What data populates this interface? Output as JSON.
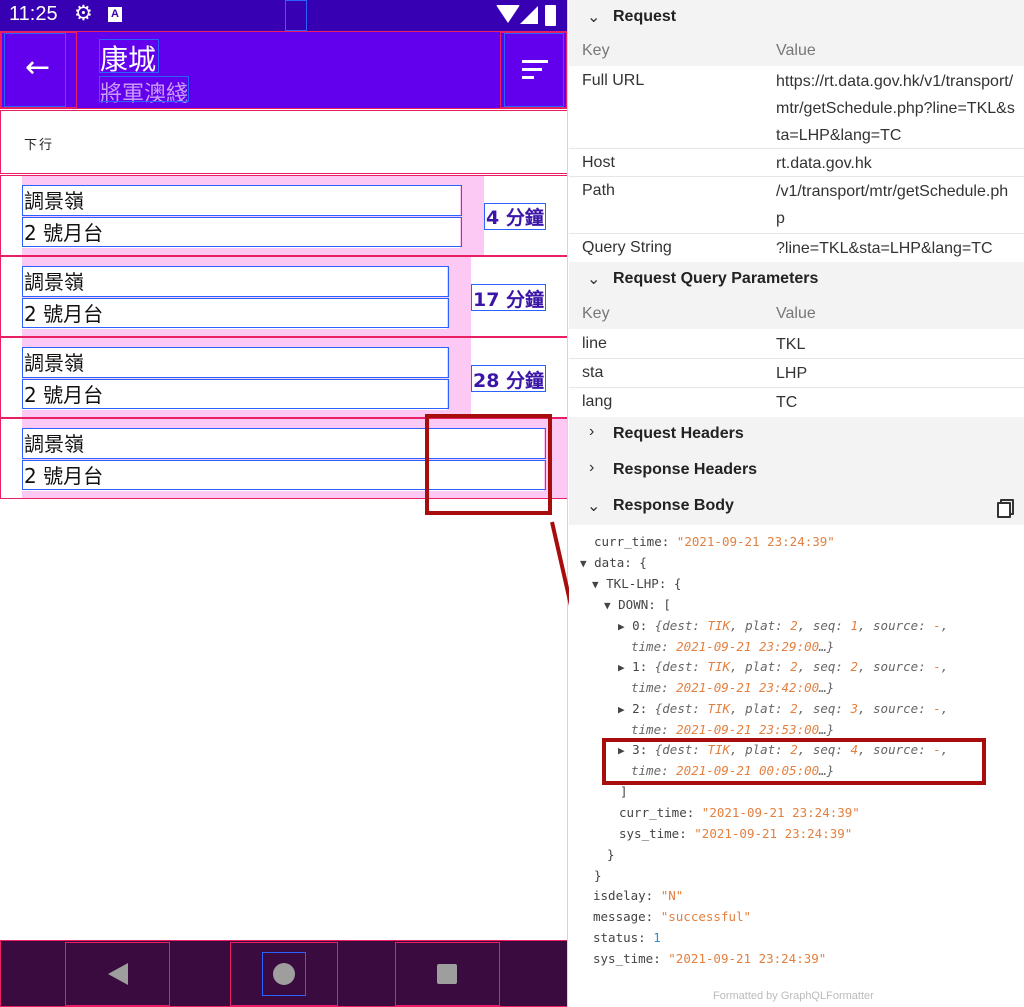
{
  "phone": {
    "status_bar": {
      "time": "11:25",
      "a_icon": "A"
    },
    "app_bar": {
      "title": "康城",
      "subtitle": "將軍澳綫"
    },
    "section_header": "下行",
    "trains": [
      {
        "dest": "調景嶺",
        "platform": "2 號月台",
        "eta": "4 分鐘"
      },
      {
        "dest": "調景嶺",
        "platform": "2 號月台",
        "eta": "17 分鐘"
      },
      {
        "dest": "調景嶺",
        "platform": "2 號月台",
        "eta": "28 分鐘"
      },
      {
        "dest": "調景嶺",
        "platform": "2 號月台",
        "eta": ""
      }
    ]
  },
  "panel": {
    "request": {
      "title": "Request",
      "col_key": "Key",
      "col_value": "Value",
      "rows": [
        {
          "key": "Full URL",
          "value": "https://rt.data.gov.hk/v1/transport/mtr/getSchedule.php?line=TKL&sta=LHP&lang=TC"
        },
        {
          "key": "Host",
          "value": "rt.data.gov.hk"
        },
        {
          "key": "Path",
          "value": "/v1/transport/mtr/getSchedule.php"
        },
        {
          "key": "Query String",
          "value": "?line=TKL&sta=LHP&lang=TC"
        }
      ]
    },
    "query_params": {
      "title": "Request Query Parameters",
      "col_key": "Key",
      "col_value": "Value",
      "rows": [
        {
          "key": "line",
          "value": "TKL"
        },
        {
          "key": "sta",
          "value": "LHP"
        },
        {
          "key": "lang",
          "value": "TC"
        }
      ]
    },
    "request_headers": {
      "title": "Request Headers"
    },
    "response_headers": {
      "title": "Response Headers"
    },
    "response_body": {
      "title": "Response Body",
      "curr_time": "\"2021-09-21 23:24:39\"",
      "line_key": "TKL-LHP",
      "direction_key": "DOWN",
      "items": [
        {
          "index": "0",
          "dest": "TIK",
          "plat": "2",
          "seq": "1",
          "source": "-",
          "time": "2021-09-21 23:29:00"
        },
        {
          "index": "1",
          "dest": "TIK",
          "plat": "2",
          "seq": "2",
          "source": "-",
          "time": "2021-09-21 23:42:00"
        },
        {
          "index": "2",
          "dest": "TIK",
          "plat": "2",
          "seq": "3",
          "source": "-",
          "time": "2021-09-21 23:53:00"
        },
        {
          "index": "3",
          "dest": "TIK",
          "plat": "2",
          "seq": "4",
          "source": "-",
          "time": "2021-09-21 00:05:00"
        }
      ],
      "inner_curr_time": "\"2021-09-21 23:24:39\"",
      "inner_sys_time": "\"2021-09-21 23:24:39\"",
      "isdelay": "\"N\"",
      "message": "\"successful\"",
      "status": "1",
      "sys_time": "\"2021-09-21 23:24:39\""
    },
    "footer": "Formatted by GraphQLFormatter"
  },
  "colors": {
    "status_bar": "#3700b3",
    "app_bar": "#6200ee",
    "row_highlight": "#fbc9f3",
    "eta_text": "#3b15a8",
    "json_string": "#e3803f",
    "json_number": "#2a8fd8",
    "annotation": "#a80d0d"
  },
  "icons": [
    "gear-icon",
    "wifi-icon",
    "signal-icon",
    "battery-icon",
    "back-arrow-icon",
    "sort-icon",
    "copy-icon",
    "nav-back-icon",
    "nav-home-icon",
    "nav-recents-icon"
  ]
}
